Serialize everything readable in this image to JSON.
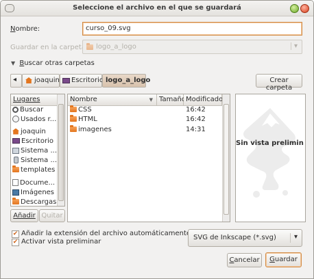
{
  "window": {
    "title": "Seleccione el archivo en el que se guardará"
  },
  "name_field": {
    "label_u": "N",
    "label_rest": "ombre:",
    "value": "curso_09.svg"
  },
  "save_in": {
    "label": "Guardar en la carpeta:",
    "value": "logo_a_logo",
    "arrow": "▾"
  },
  "browse": {
    "toggle": "▼",
    "label_u": "B",
    "label_rest": "uscar otras carpetas"
  },
  "breadcrumb": {
    "back": "◂",
    "items": [
      "joaquin",
      "Escritorio",
      "logo_a_logo"
    ]
  },
  "create_folder": {
    "label": "Crear carpeta",
    "u": "p"
  },
  "places": {
    "header": "Lugares",
    "items": [
      {
        "icon": "search-icon",
        "label": "Buscar"
      },
      {
        "icon": "recent-icon",
        "label": "Usados r..."
      },
      {
        "icon": "home-icon",
        "label": "joaquin"
      },
      {
        "icon": "desktop-icon",
        "label": "Escritorio"
      },
      {
        "icon": "filesystem-icon",
        "label": "Sistema ..."
      },
      {
        "icon": "drive-icon",
        "label": "Sistema ..."
      },
      {
        "icon": "folder-icon",
        "label": "templates"
      },
      {
        "icon": "documents-icon",
        "label": "Docume..."
      },
      {
        "icon": "images-icon",
        "label": "Imágenes"
      },
      {
        "icon": "downloads-icon",
        "label": "Descargas"
      }
    ],
    "add_button": "Añadir",
    "remove_button": "Quitar"
  },
  "files": {
    "columns": {
      "name": "Nombre",
      "size": "Tamaño",
      "modified": "Modificado",
      "sort": "▼"
    },
    "rows": [
      {
        "name": "CSS",
        "size": "",
        "modified": "16:42"
      },
      {
        "name": "HTML",
        "size": "",
        "modified": "16:42"
      },
      {
        "name": "imagenes",
        "size": "",
        "modified": "14:31"
      }
    ]
  },
  "preview": {
    "text": "Sin vista prelimin"
  },
  "options": {
    "auto_extension": "Añadir la extensión del archivo automáticamente",
    "show_preview": "Activar vista preliminar",
    "check": "✔"
  },
  "file_type": {
    "value": "SVG de Inkscape (*.svg)",
    "arrow": "▾"
  },
  "buttons": {
    "cancel_u": "C",
    "cancel_rest": "ancelar",
    "save_u": "G",
    "save_rest": "uardar"
  }
}
